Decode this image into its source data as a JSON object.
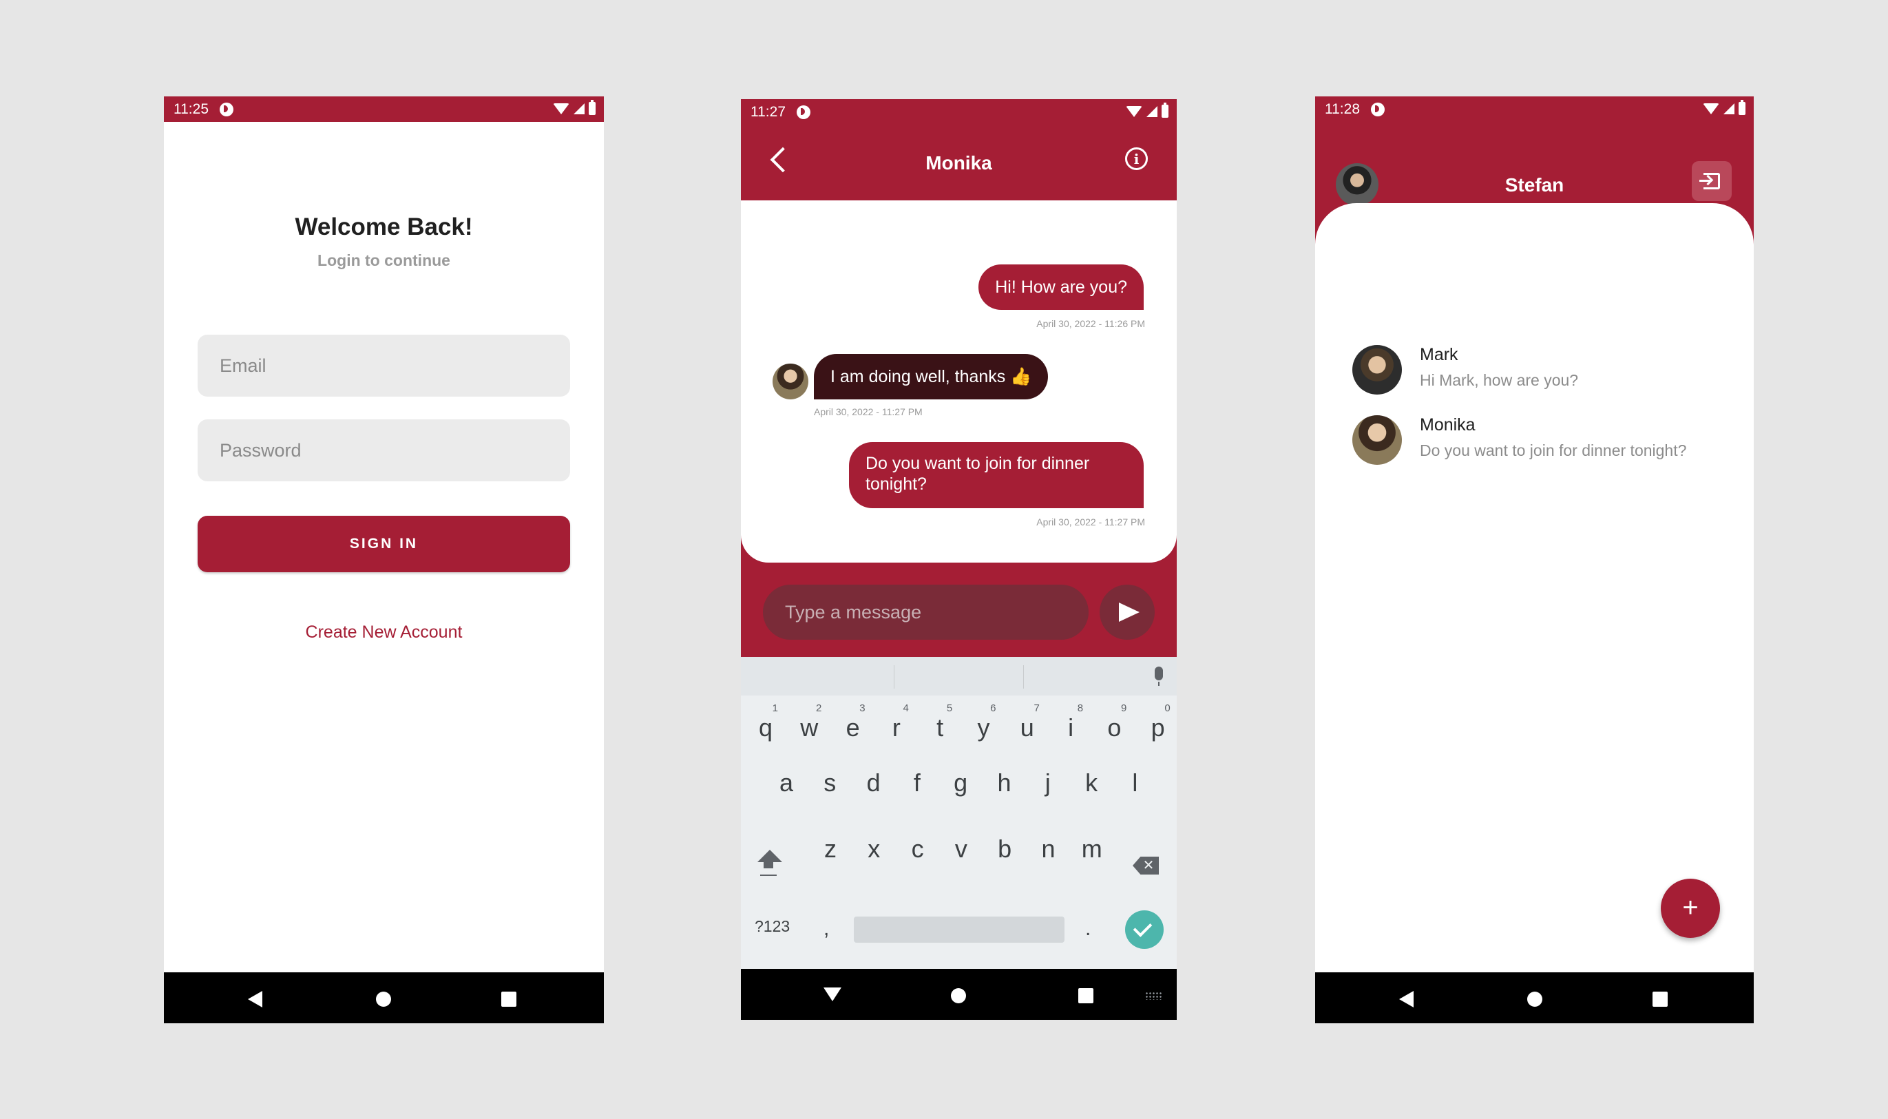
{
  "colors": {
    "brand": "#a51e35",
    "background": "#e6e6e6",
    "received_bubble": "#3a1216",
    "enter_key": "#4db6ac"
  },
  "login_screen": {
    "status_time": "11:25",
    "title": "Welcome Back!",
    "subtitle": "Login to continue",
    "email_placeholder": "Email",
    "password_placeholder": "Password",
    "signin_label": "SIGN IN",
    "create_account_label": "Create New Account"
  },
  "chat_screen": {
    "status_time": "11:27",
    "contact_name": "Monika",
    "messages": [
      {
        "direction": "sent",
        "text": "Hi! How are you?",
        "time": "April 30, 2022 - 11:26 PM"
      },
      {
        "direction": "received",
        "text": "I am doing well, thanks 👍",
        "time": "April 30, 2022 - 11:27 PM"
      },
      {
        "direction": "sent",
        "text": "Do you want to join for dinner tonight?",
        "time": "April 30, 2022 - 11:27 PM"
      }
    ],
    "input_placeholder": "Type a message",
    "keyboard": {
      "row1": [
        {
          "key": "q",
          "hint": "1"
        },
        {
          "key": "w",
          "hint": "2"
        },
        {
          "key": "e",
          "hint": "3"
        },
        {
          "key": "r",
          "hint": "4"
        },
        {
          "key": "t",
          "hint": "5"
        },
        {
          "key": "y",
          "hint": "6"
        },
        {
          "key": "u",
          "hint": "7"
        },
        {
          "key": "i",
          "hint": "8"
        },
        {
          "key": "o",
          "hint": "9"
        },
        {
          "key": "p",
          "hint": "0"
        }
      ],
      "row2": [
        "a",
        "s",
        "d",
        "f",
        "g",
        "h",
        "j",
        "k",
        "l"
      ],
      "row3": [
        "z",
        "x",
        "c",
        "v",
        "b",
        "n",
        "m"
      ],
      "symbols_label": "?123",
      "comma": ",",
      "period": "."
    }
  },
  "contacts_screen": {
    "status_time": "11:28",
    "user_name": "Stefan",
    "contacts": [
      {
        "name": "Mark",
        "preview": "Hi Mark, how are you?"
      },
      {
        "name": "Monika",
        "preview": "Do you want to join for dinner tonight?"
      }
    ],
    "fab_label": "+"
  },
  "icons": [
    "wifi-icon",
    "signal-icon",
    "battery-icon",
    "back-chevron-icon",
    "info-icon",
    "send-icon",
    "mic-icon",
    "shift-icon",
    "backspace-icon",
    "check-icon",
    "logout-icon",
    "plus-icon"
  ]
}
